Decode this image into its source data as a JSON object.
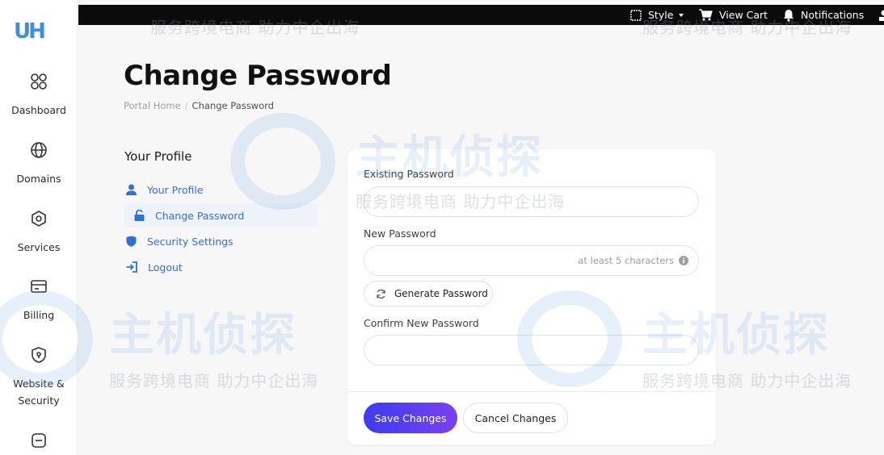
{
  "app": {
    "logo_text": "UH",
    "logo_accent": "#3d8fe0"
  },
  "sidebar": {
    "items": [
      {
        "label": "Dashboard",
        "icon": "dashboard-grid-icon"
      },
      {
        "label": "Domains",
        "icon": "globe-icon"
      },
      {
        "label": "Services",
        "icon": "hexagon-gear-icon"
      },
      {
        "label": "Billing",
        "icon": "credit-card-icon"
      },
      {
        "label": "Website & Security",
        "icon": "shield-icon"
      },
      {
        "label": "",
        "icon": "minus-box-icon"
      }
    ]
  },
  "topbar": {
    "style_label": "Style",
    "view_cart_label": "View Cart",
    "notifications_label": "Notifications"
  },
  "header": {
    "title": "Change Password",
    "breadcrumb_home": "Portal Home",
    "breadcrumb_sep": "/",
    "breadcrumb_current": "Change Password"
  },
  "profile_menu": {
    "title": "Your Profile",
    "items": [
      {
        "label": "Your Profile",
        "icon": "user-icon"
      },
      {
        "label": "Change Password",
        "icon": "unlock-icon",
        "active": true
      },
      {
        "label": "Security Settings",
        "icon": "shield-icon"
      },
      {
        "label": "Logout",
        "icon": "logout-icon"
      }
    ]
  },
  "form": {
    "existing_label": "Existing Password",
    "existing_value": "",
    "new_label": "New Password",
    "new_value": "",
    "new_hint": "at least 5 characters",
    "generate_label": "Generate Password",
    "confirm_label": "Confirm New Password",
    "confirm_value": "",
    "save_label": "Save Changes",
    "cancel_label": "Cancel Changes"
  },
  "watermark": {
    "big_text": "主机侦探",
    "small_text": "服务跨境电商 助力中企出海"
  },
  "colors": {
    "primary_link": "#2f6fd6",
    "save_gradient_start": "#3b3df0",
    "save_gradient_end": "#7a40f2",
    "topbar_bg": "#0b0b0b"
  }
}
